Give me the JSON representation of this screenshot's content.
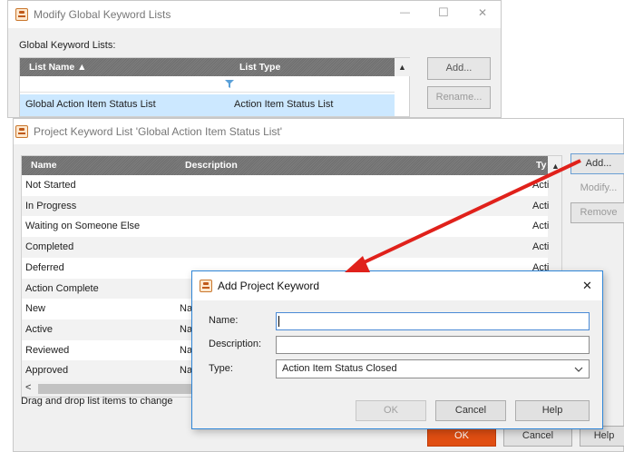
{
  "back_window": {
    "title": "Modify Global Keyword Lists",
    "section_label": "Global Keyword Lists:",
    "columns": [
      "List Name ▲",
      "List Type"
    ],
    "row": {
      "name": "Global Action Item Status List",
      "type": "Action Item Status List"
    },
    "buttons": {
      "add": "Add...",
      "rename": "Rename..."
    },
    "controls": {
      "minimize": "—",
      "maximize": "☐",
      "close": "✕"
    }
  },
  "project_window": {
    "title": "Project Keyword List 'Global Action Item Status List'",
    "columns": {
      "name": "Name",
      "description": "Description",
      "type": "Ty"
    },
    "rows": [
      {
        "name": "Not Started",
        "description": "",
        "type": "Acti"
      },
      {
        "name": "In Progress",
        "description": "",
        "type": "Acti"
      },
      {
        "name": "Waiting on Someone Else",
        "description": "",
        "type": "Acti"
      },
      {
        "name": "Completed",
        "description": "",
        "type": "Acti"
      },
      {
        "name": "Deferred",
        "description": "",
        "type": "Acti"
      },
      {
        "name": "Action Complete",
        "description": "",
        "type": ""
      },
      {
        "name": "New",
        "description": "Na",
        "type": ""
      },
      {
        "name": "Active",
        "description": "Na",
        "type": ""
      },
      {
        "name": "Reviewed",
        "description": "Na",
        "type": ""
      },
      {
        "name": "Approved",
        "description": "Na",
        "type": ""
      }
    ],
    "buttons": {
      "add": "Add...",
      "modify": "Modify...",
      "remove": "Remove",
      "ok": "OK",
      "cancel": "Cancel",
      "help": "Help"
    },
    "hint": "Drag and drop list items to change",
    "scroll_left": "<"
  },
  "dialog": {
    "title": "Add Project Keyword",
    "labels": {
      "name": "Name:",
      "description": "Description:",
      "type": "Type:"
    },
    "values": {
      "name": "",
      "description": "",
      "type": "Action Item Status Closed"
    },
    "buttons": {
      "ok": "OK",
      "cancel": "Cancel",
      "help": "Help"
    },
    "close": "✕"
  },
  "colors": {
    "arrow": "#e0211b",
    "selected_row": "#cce8ff",
    "accent_border": "#2f86d8"
  }
}
